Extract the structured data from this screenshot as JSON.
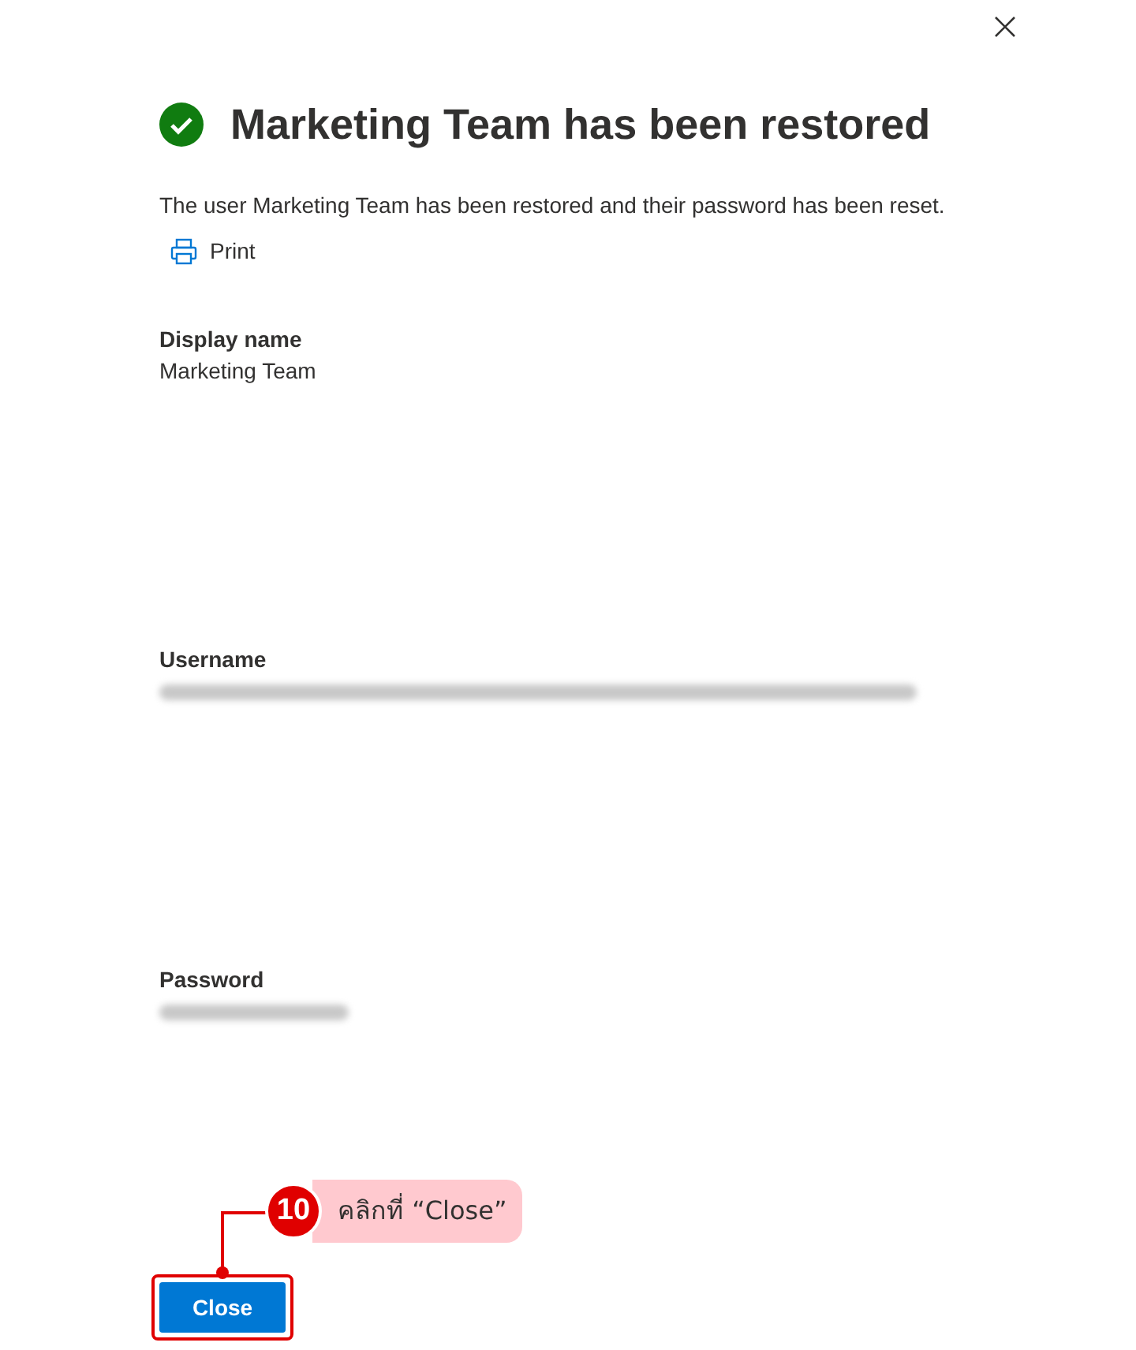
{
  "dialog": {
    "title": "Marketing Team has been restored",
    "message": "The user Marketing Team has been restored and their password has been reset.",
    "print_button": "Print",
    "fields": [
      {
        "label": "Display name",
        "kind": "text",
        "value": "Marketing Team"
      },
      {
        "label": "Username",
        "kind": "blurred"
      },
      {
        "label": "Password",
        "kind": "blurred"
      }
    ],
    "close_button": "Close"
  },
  "annotation": {
    "step": "10",
    "text": "คลิกที่ “Close”"
  }
}
